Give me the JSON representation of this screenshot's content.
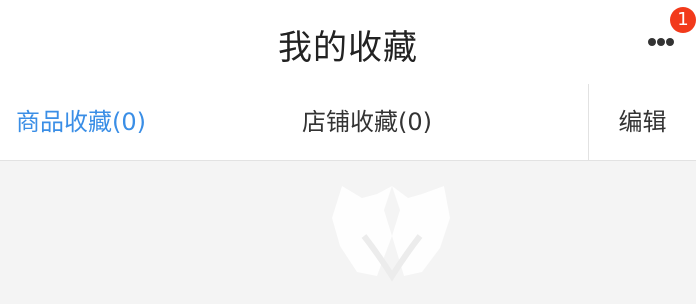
{
  "header": {
    "title": "我的收藏",
    "more_icon": "ellipsis-icon",
    "notification_count": "1",
    "badge_color": "#f23a1b"
  },
  "tabs": [
    {
      "label": "商品收藏(0)",
      "active": true
    },
    {
      "label": "店铺收藏(0)",
      "active": false
    }
  ],
  "edit_label": "编辑",
  "colors": {
    "accent": "#3a8ee6",
    "background": "#f4f4f4"
  }
}
